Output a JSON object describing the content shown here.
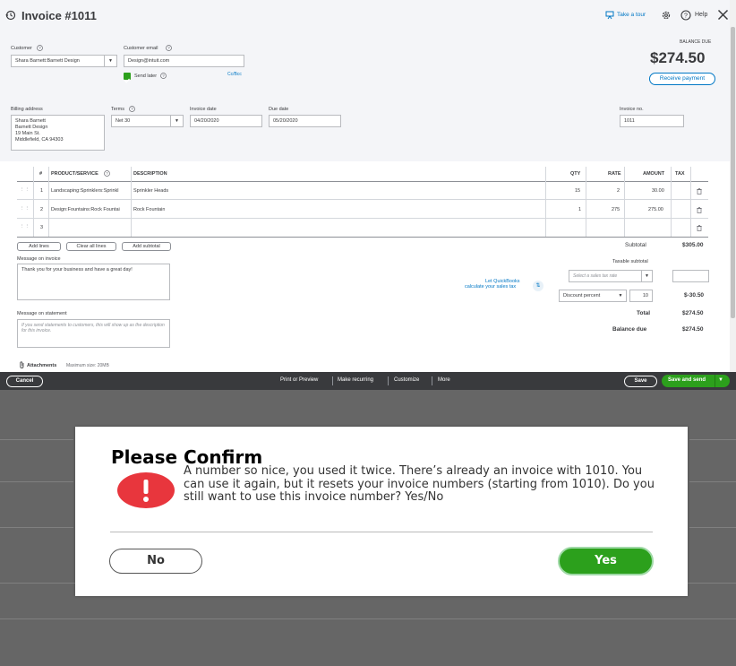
{
  "header": {
    "title": "Invoice #1011",
    "take_tour": "Take a tour",
    "help": "Help",
    "balance_due_label": "BALANCE DUE",
    "balance_due_amount": "$274.50",
    "receive_payment": "Receive payment"
  },
  "customer": {
    "customer_label": "Customer",
    "customer_value": "Shara Barnett:Barnett Design",
    "email_label": "Customer email",
    "email_value": "Design@intuit.com",
    "send_later": "Send later",
    "cc_bcc": "Cc/Bcc",
    "billing_label": "Billing address",
    "billing_lines": [
      "Shara Barnett",
      "Barnett Design",
      "19 Main St.",
      "Middlefield, CA  94303"
    ],
    "terms_label": "Terms",
    "terms_value": "Net 30",
    "invoice_date_label": "Invoice date",
    "invoice_date_value": "04/20/2020",
    "due_date_label": "Due date",
    "due_date_value": "05/20/2020",
    "invoice_no_label": "Invoice no.",
    "invoice_no_value": "1011"
  },
  "table": {
    "headers": {
      "num": "#",
      "product": "PRODUCT/SERVICE",
      "description": "DESCRIPTION",
      "qty": "QTY",
      "rate": "RATE",
      "amount": "AMOUNT",
      "tax": "TAX"
    },
    "rows": [
      {
        "num": "1",
        "product": "Landscaping:Sprinklers:Sprinkl",
        "description": "Sprinkler Heads",
        "qty": "15",
        "rate": "2",
        "amount": "30.00"
      },
      {
        "num": "2",
        "product": "Design:Fountains:Rock Fountai",
        "description": "Rock Fountain",
        "qty": "1",
        "rate": "275",
        "amount": "275.00"
      },
      {
        "num": "3",
        "product": "",
        "description": "",
        "qty": "",
        "rate": "",
        "amount": ""
      }
    ],
    "add_lines": "Add lines",
    "clear_all_lines": "Clear all lines",
    "add_subtotal": "Add subtotal"
  },
  "totals": {
    "subtotal_label": "Subtotal",
    "subtotal_value": "$305.00",
    "taxable_subtotal": "Taxable subtotal",
    "qb_tax_line1": "Let QuickBooks",
    "qb_tax_line2": "calculate your sales tax",
    "tax_rate_placeholder": "Select a sales tax rate",
    "discount_type": "Discount percent",
    "discount_value": "10",
    "discount_amount": "$-30.50",
    "total_label": "Total",
    "total_value": "$274.50",
    "balance_label": "Balance due",
    "balance_value": "$274.50"
  },
  "messages": {
    "invoice_label": "Message on invoice",
    "invoice_text": "Thank you for your business and have a great day!",
    "statement_label": "Message on statement",
    "statement_placeholder": "If you send statements to customers, this will show up as the description for this invoice.",
    "attachments": "Attachments",
    "max_size": "Maximum size: 20MB"
  },
  "footer": {
    "cancel": "Cancel",
    "print_preview": "Print or Preview",
    "make_recurring": "Make recurring",
    "customize": "Customize",
    "more": "More",
    "save": "Save",
    "save_and_send": "Save and send"
  },
  "dialog": {
    "title": "Please Confirm",
    "message": "A number so nice, you used it twice. There’s already an invoice with 1010. You can use it again, but it resets your invoice numbers (starting from 1010). Do you still want to use this invoice number? Yes/No",
    "no": "No",
    "yes": "Yes"
  },
  "colors": {
    "accent_green": "#2ca01c",
    "link_blue": "#0077c5",
    "alert_red": "#e8363d",
    "footer_dark": "#393a3d"
  }
}
